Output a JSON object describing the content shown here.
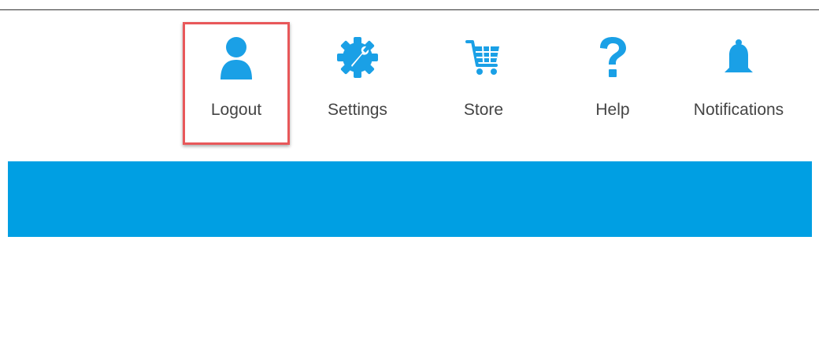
{
  "toolbar": {
    "items": [
      {
        "label": "Logout",
        "icon": "user-icon",
        "highlighted": true
      },
      {
        "label": "Settings",
        "icon": "gear-wrench-icon",
        "highlighted": false
      },
      {
        "label": "Store",
        "icon": "cart-icon",
        "highlighted": false
      },
      {
        "label": "Help",
        "icon": "question-icon",
        "highlighted": false
      },
      {
        "label": "Notifications",
        "icon": "bell-icon",
        "highlighted": false
      }
    ]
  },
  "colors": {
    "accent": "#009fe3",
    "icon": "#1aa0e6",
    "label": "#444444",
    "highlight_frame": "#e8585a",
    "banner": "#009fe3"
  }
}
